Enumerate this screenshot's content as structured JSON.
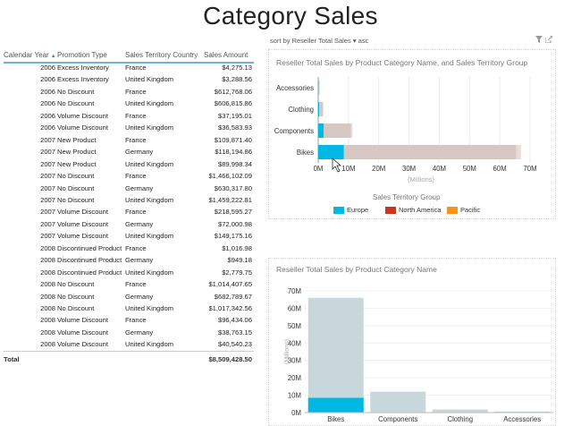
{
  "page": {
    "title": "Category Sales"
  },
  "table": {
    "columns": [
      "Calendar Year",
      "Promotion Type",
      "Sales Territory Country",
      "Sales Amount"
    ],
    "rows": [
      [
        "2006",
        "Excess Inventory",
        "France",
        "$4,275.13"
      ],
      [
        "2006",
        "Excess Inventory",
        "United Kingdom",
        "$3,288.56"
      ],
      [
        "2006",
        "No Discount",
        "France",
        "$612,768.06"
      ],
      [
        "2006",
        "No Discount",
        "United Kingdom",
        "$606,815.86"
      ],
      [
        "2006",
        "Volume Discount",
        "France",
        "$37,195.01"
      ],
      [
        "2006",
        "Volume Discount",
        "United Kingdom",
        "$36,583.93"
      ],
      [
        "2007",
        "New Product",
        "France",
        "$109,871.40"
      ],
      [
        "2007",
        "New Product",
        "Germany",
        "$118,194.86"
      ],
      [
        "2007",
        "New Product",
        "United Kingdom",
        "$89,998.34"
      ],
      [
        "2007",
        "No Discount",
        "France",
        "$1,466,102.09"
      ],
      [
        "2007",
        "No Discount",
        "Germany",
        "$630,317.80"
      ],
      [
        "2007",
        "No Discount",
        "United Kingdom",
        "$1,459,222.81"
      ],
      [
        "2007",
        "Volume Discount",
        "France",
        "$218,595.27"
      ],
      [
        "2007",
        "Volume Discount",
        "Germany",
        "$72,000.98"
      ],
      [
        "2007",
        "Volume Discount",
        "United Kingdom",
        "$149,175.16"
      ],
      [
        "2008",
        "Discontinued Product",
        "France",
        "$1,016.98"
      ],
      [
        "2008",
        "Discontinued Product",
        "Germany",
        "$949.18"
      ],
      [
        "2008",
        "Discontinued Product",
        "United Kingdom",
        "$2,779.75"
      ],
      [
        "2008",
        "No Discount",
        "France",
        "$1,014,407.65"
      ],
      [
        "2008",
        "No Discount",
        "Germany",
        "$682,789.67"
      ],
      [
        "2008",
        "No Discount",
        "United Kingdom",
        "$1,017,342.56"
      ],
      [
        "2008",
        "Volume Discount",
        "France",
        "$96,434.06"
      ],
      [
        "2008",
        "Volume Discount",
        "Germany",
        "$38,763.15"
      ],
      [
        "2008",
        "Volume Discount",
        "United Kingdom",
        "$40,540.23"
      ]
    ],
    "total_label": "Total",
    "total_amount": "$8,509,428.50"
  },
  "toolbar": {
    "sort_text": "sort by  Reseller Total Sales ▾ asc",
    "filter_icon": "filter-icon",
    "popout_icon": "popout-icon"
  },
  "chart_data": [
    {
      "type": "bar",
      "orientation": "horizontal",
      "stacked": true,
      "title": "Reseller Total Sales by Product Category Name, and Sales Territory Group",
      "categories": [
        "Accessories",
        "Clothing",
        "Components",
        "Bikes"
      ],
      "series": [
        {
          "name": "Europe",
          "values": [
            0.1,
            0.3,
            1.8,
            8.5
          ]
        },
        {
          "name": "North America",
          "values": [
            0.3,
            1.2,
            9.0,
            57.0
          ]
        },
        {
          "name": "Pacific",
          "values": [
            0.05,
            0.2,
            0.5,
            1.5
          ]
        }
      ],
      "xlabel": "(Millions)",
      "xticks": [
        "0M",
        "10M",
        "20M",
        "30M",
        "40M",
        "50M",
        "60M",
        "70M"
      ],
      "xlim": [
        0,
        70
      ],
      "legend_title": "Sales Territory Group",
      "legend_position": "bottom",
      "colors": {
        "Europe": "#01b8e2",
        "North America": "#c8371f",
        "Pacific": "#f6941d"
      },
      "dimmed_color": "#d6c7c2"
    },
    {
      "type": "bar",
      "orientation": "vertical",
      "title": "Reseller Total Sales by Product Category Name",
      "categories": [
        "Bikes",
        "Components",
        "Clothing",
        "Accessories"
      ],
      "values": [
        66.0,
        12.0,
        1.8,
        0.6
      ],
      "highlighted_values": [
        8.5,
        0,
        0,
        0
      ],
      "ylabel": "(Millions)",
      "yticks": [
        "0M",
        "10M",
        "20M",
        "30M",
        "40M",
        "50M",
        "60M",
        "70M"
      ],
      "ylim": [
        0,
        70
      ],
      "colors": {
        "base": "#c7d7dc",
        "highlight": "#01b8e2"
      }
    }
  ]
}
